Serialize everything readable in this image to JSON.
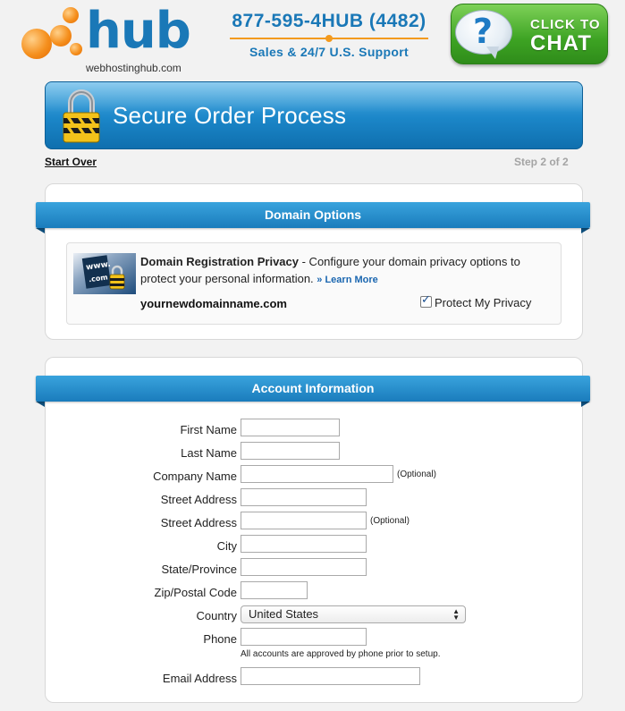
{
  "header": {
    "logo_text": "hub",
    "logo_sub": "webhostinghub.com",
    "phone_number": "877-595-4HUB (4482)",
    "phone_sub": "Sales & 24/7 U.S. Support",
    "chat_line1": "CLICK TO",
    "chat_line2": "CHAT",
    "chat_icon_glyph": "?"
  },
  "banner": {
    "title": "Secure Order Process"
  },
  "nav": {
    "start_over": "Start Over",
    "step": "Step 2 of 2"
  },
  "domain_options": {
    "heading": "Domain Options",
    "privacy_title": "Domain Registration Privacy",
    "privacy_desc": " - Configure your domain privacy options to protect your personal information. ",
    "learn_more": "» Learn More",
    "domain_name": "yournewdomainname.com",
    "protect_label": "Protect My Privacy",
    "protect_checked": true,
    "image_text_1": "www.",
    "image_text_2": ".com"
  },
  "account": {
    "heading": "Account Information",
    "fields": [
      {
        "label": "First Name",
        "value": ""
      },
      {
        "label": "Last Name",
        "value": ""
      },
      {
        "label": "Company Name",
        "value": "",
        "note": "(Optional)"
      },
      {
        "label": "Street Address",
        "value": ""
      },
      {
        "label": "Street Address",
        "value": "",
        "note": "(Optional)"
      },
      {
        "label": "City",
        "value": ""
      },
      {
        "label": "State/Province",
        "value": ""
      },
      {
        "label": "Zip/Postal Code",
        "value": ""
      },
      {
        "label": "Country",
        "value": "United States"
      },
      {
        "label": "Phone",
        "value": "",
        "note": "All accounts are approved by phone prior to setup."
      },
      {
        "label": "Email Address",
        "value": ""
      }
    ]
  },
  "colors": {
    "brand_blue": "#1a78b7",
    "accent_orange": "#f39a1e",
    "chat_green": "#3da323",
    "step_gray": "#a4a4a4"
  }
}
